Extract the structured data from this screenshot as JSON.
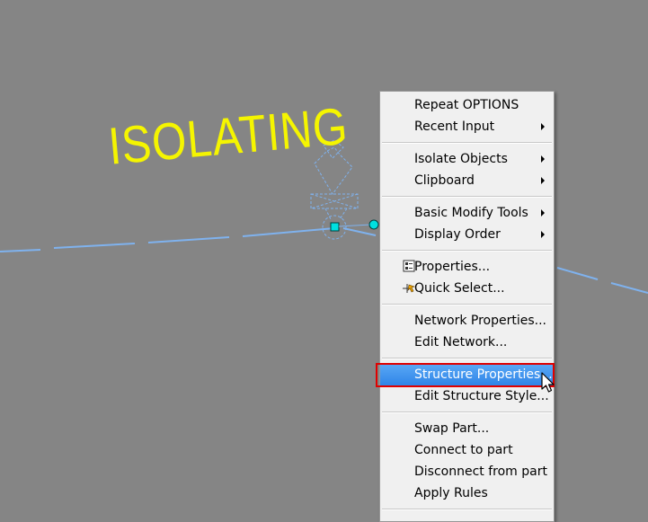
{
  "canvas": {
    "label_text": "ISOLATING",
    "label_color": "#f5f500",
    "background_color": "#858585",
    "line_color": "#7fb2ee"
  },
  "context_menu": {
    "groups": [
      [
        {
          "label": "Repeat OPTIONS",
          "submenu": false
        },
        {
          "label": "Recent Input",
          "submenu": true
        }
      ],
      [
        {
          "label": "Isolate Objects",
          "submenu": true
        },
        {
          "label": "Clipboard",
          "submenu": true
        }
      ],
      [
        {
          "label": "Basic Modify Tools",
          "submenu": true
        },
        {
          "label": "Display Order",
          "submenu": true
        }
      ],
      [
        {
          "label": "Properties...",
          "submenu": false,
          "icon": "properties-icon"
        },
        {
          "label": "Quick Select...",
          "submenu": false,
          "icon": "quick-select-icon"
        }
      ],
      [
        {
          "label": "Network Properties...",
          "submenu": false
        },
        {
          "label": "Edit Network...",
          "submenu": false
        }
      ],
      [
        {
          "label": "Structure Properties...",
          "submenu": false,
          "highlighted": true
        },
        {
          "label": "Edit Structure Style...",
          "submenu": false
        }
      ],
      [
        {
          "label": "Swap Part...",
          "submenu": false
        },
        {
          "label": "Connect to part",
          "submenu": false
        },
        {
          "label": "Disconnect from part",
          "submenu": false
        },
        {
          "label": "Apply Rules",
          "submenu": false
        }
      ]
    ],
    "highlight_color": "#3a8ef0",
    "focus_outline_color": "#e00000"
  }
}
